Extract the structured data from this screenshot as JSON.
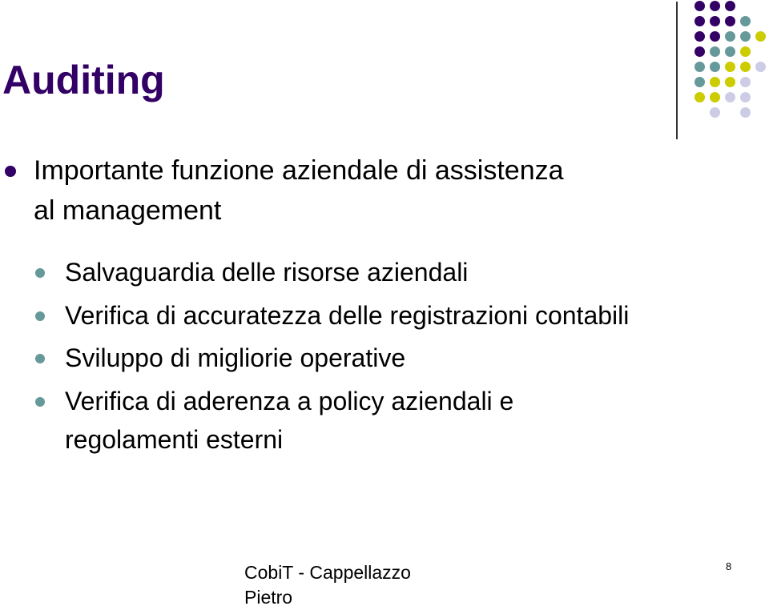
{
  "slide": {
    "title": "Auditing",
    "main_bullet": {
      "line1": "Importante funzione aziendale di assistenza",
      "line2": "al management"
    },
    "sub_bullets": [
      {
        "line1": "Salvaguardia delle risorse aziendali"
      },
      {
        "line1": "Verifica di accuratezza delle registrazioni contabili"
      },
      {
        "line1": "Sviluppo di migliorie operative"
      },
      {
        "line1": "Verifica di aderenza a policy aziendali e",
        "line2": "regolamenti esterni"
      }
    ],
    "footer": {
      "line1": "CobiT - Cappellazzo",
      "line2": "Pietro"
    },
    "page_number": "8"
  },
  "theme": {
    "purple": "#330066",
    "teal": "#669999",
    "yellow": "#CCCC00",
    "lavender": "#CCCCE6",
    "dot_pattern": [
      "PPP  ",
      "PPPT ",
      "PPTTY",
      "PTTY ",
      "TTYYL",
      "TYYL ",
      "YYLL ",
      " L L "
    ]
  }
}
